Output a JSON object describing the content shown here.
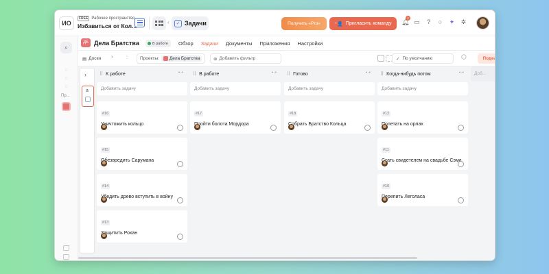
{
  "topbar": {
    "ws_initials": "ИО",
    "ws_plan": "FREE",
    "ws_label": "Рабочее пространство",
    "ws_name": "Избавиться от Кол...",
    "tab_label": "Задачи",
    "pro_label": "Получить «Pro»",
    "invite_label": "Пригласить команду",
    "notif_count": "2"
  },
  "rail": {
    "projects_label": "Пр..."
  },
  "project": {
    "icon_text": "ДБ",
    "title": "Дела Братства",
    "status": "В работе",
    "status_color": "#3aa65a",
    "tabs": [
      "Обзор",
      "Задачи",
      "Документы",
      "Приложения",
      "Настройки"
    ],
    "active_tab": "Задачи"
  },
  "toolbar": {
    "docs_label": "Доски",
    "projects_label": "Проекты:",
    "project_chip": "Дела Братства",
    "add_filter": "Добавить фильтр",
    "sort_label": "По умолчанию",
    "share_label": "Поделиться"
  },
  "board": {
    "collapsed_letter": "а",
    "add_task_label": "Добавить задачу",
    "ghost_label": "Доб...",
    "columns": [
      {
        "title": "К работе",
        "cards": [
          {
            "num": "#16",
            "title": "Уничтожить кольцо"
          },
          {
            "num": "#15",
            "title": "Обезвредить Сарумана"
          },
          {
            "num": "#14",
            "title": "Убедить древо вступить в войну"
          },
          {
            "num": "#13",
            "title": "Защитить Рохан"
          }
        ]
      },
      {
        "title": "В работе",
        "cards": [
          {
            "num": "#17",
            "title": "Пройти болота Мордора"
          }
        ]
      },
      {
        "title": "Готово",
        "cards": [
          {
            "num": "#18",
            "title": "Собрать Братство Кольца"
          }
        ]
      },
      {
        "title": "Когда-нибудь потом",
        "cards": [
          {
            "num": "#12",
            "title": "Полетать на орлах"
          },
          {
            "num": "#11",
            "title": "Стать свидетелем на свадьбе Сэма"
          },
          {
            "num": "#10",
            "title": "Перепить Леголаса"
          }
        ]
      }
    ]
  },
  "colors": {
    "accent": "#e8694f",
    "pro_gradient_start": "#f08b4a",
    "project_icon": "#e57373"
  }
}
